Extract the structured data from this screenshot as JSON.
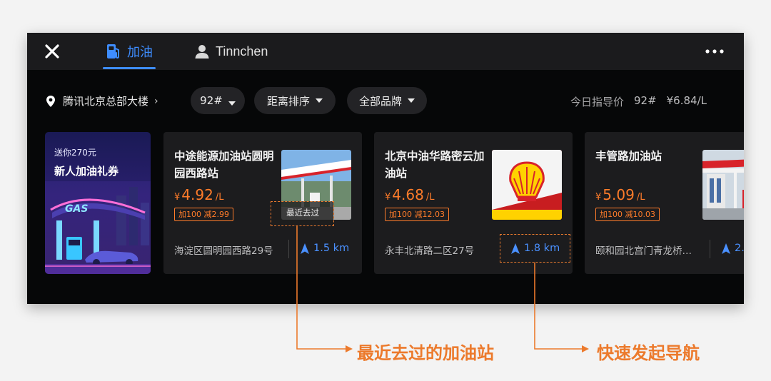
{
  "topbar": {
    "tabs": [
      {
        "label": "加油",
        "icon": "gas-pump-icon",
        "active": true
      },
      {
        "label": "Tinnchen",
        "icon": "user-icon",
        "active": false
      }
    ],
    "close_icon": "close-icon",
    "more_icon": "more-horizontal-icon"
  },
  "filters": {
    "location": "腾讯北京总部大楼",
    "fuel_grade": "92#",
    "sort": "距离排序",
    "brand": "全部品牌",
    "guide_price": {
      "label": "今日指导价",
      "grade": "92#",
      "price": "¥6.84/L"
    }
  },
  "promo": {
    "line1": "送你270元",
    "line2": "新人加油礼券",
    "art_text": "GAS"
  },
  "stations": [
    {
      "name": "中途能源加油站圆明园西路站",
      "currency": "¥",
      "price": "4.92",
      "unit": "/L",
      "discount": "加100 减2.99",
      "address": "海淀区圆明园西路29号",
      "distance": "1.5 km",
      "tag": "最近去过"
    },
    {
      "name": "北京中油华路密云加油站",
      "currency": "¥",
      "price": "4.68",
      "unit": "/L",
      "discount": "加100 减12.03",
      "address": "永丰北清路二区27号",
      "distance": "1.8 km"
    },
    {
      "name": "丰管路加油站",
      "currency": "¥",
      "price": "5.09",
      "unit": "/L",
      "discount": "加100 减10.03",
      "address": "颐和园北宫门青龙桥…",
      "distance": "2.…"
    }
  ],
  "annotations": {
    "recent": "最近去过的加油站",
    "navigate": "快速发起导航"
  },
  "colors": {
    "accent_blue": "#3e8dff",
    "price_orange": "#ff7c2a",
    "annotation_orange": "#ec7a2c",
    "background_dark": "#060708"
  }
}
